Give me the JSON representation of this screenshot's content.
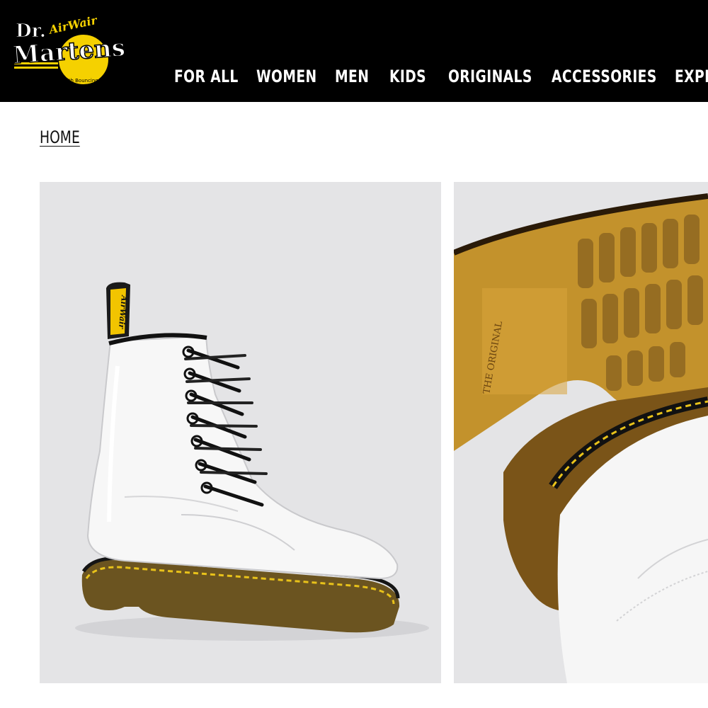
{
  "header": {
    "logo": {
      "brand_line1": "Dr.",
      "brand_line2": "Martens",
      "airwair": "AirWair",
      "tagline": "With Bouncing Soles"
    },
    "nav": [
      "FOR ALL",
      "WOMEN",
      "MEN",
      "KIDS",
      "ORIGINALS",
      "ACCESSORIES",
      "EXPL"
    ]
  },
  "breadcrumb": {
    "home": "HOME"
  },
  "gallery": {
    "images": [
      {
        "name": "white-patent-boot-side-view",
        "pull_tab_text": "AirWair"
      },
      {
        "name": "boot-sole-close-up",
        "sole_text": "THE ORIGINAL"
      }
    ]
  },
  "colors": {
    "header_bg": "#000000",
    "brand_yellow": "#f5d100",
    "gallery_bg": "#e4e4e6"
  }
}
